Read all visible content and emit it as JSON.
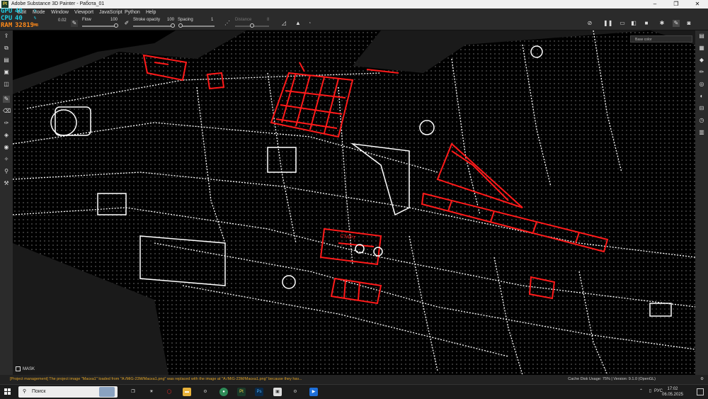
{
  "window": {
    "app_icon": "Pt",
    "title": "Adobe Substance 3D Painter - Работа_01",
    "minimize": "–",
    "maximize": "❐",
    "close": "✕"
  },
  "menu": {
    "items": [
      "Edit",
      "Mode",
      "Window",
      "Viewport",
      "JavaScript",
      "Python",
      "Help"
    ]
  },
  "hud": {
    "gpu_label": "GPU",
    "gpu_value": "40",
    "gpu_unit": "%",
    "cpu_label": "CPU",
    "cpu_value": "40",
    "cpu_unit": "%",
    "ram_label": "RAM",
    "ram_value": "32819",
    "ram_unit": "MB",
    "colors": {
      "gpu": "#1ecbe1",
      "cpu": "#1ecbe1",
      "ram": "#ff8a1a"
    }
  },
  "toolbar": {
    "size_value": "0.02",
    "flow_label": "Flow",
    "flow_value": "100",
    "stroke_opacity_label": "Stroke opacity",
    "stroke_opacity_value": "100",
    "spacing_label": "Spacing",
    "spacing_value": "1",
    "distance_label": "Distance",
    "distance_value": "8",
    "flow_fraction": 1.0,
    "stroke_opacity_fraction": 1.0,
    "spacing_fraction": 0.0,
    "distance_fraction": 0.5
  },
  "viewport": {
    "mask_label": "MASK",
    "stamp_text": "СТАРТ",
    "colors": {
      "panel_line": "#ffffff",
      "mask_line": "#ff1a1a",
      "background": "#000000"
    }
  },
  "right_panel": {
    "selector_text": "Base color"
  },
  "status": {
    "message": "[Project management] The project image \"Маска1\" loaded from \"A:/MiG-23M/Маска1.png\" was replaced with the image at \"A:/MiG-23M/Маска1.png\" because they hav...",
    "disk_usage": "Cache Disk Usage:  75% | Version: 9.1.0 (OpenGL)"
  },
  "taskbar": {
    "search_placeholder": "Поиск",
    "language": "РУС",
    "time": "17:02",
    "date": "06.05.2025"
  }
}
